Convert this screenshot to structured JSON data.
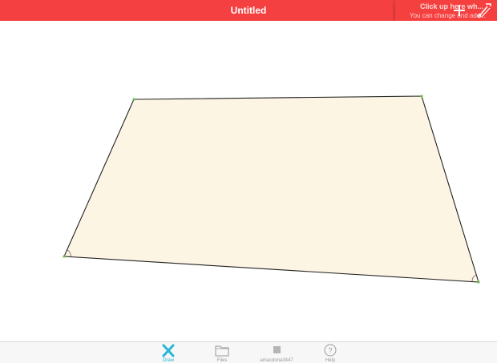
{
  "header": {
    "title": "Untitled",
    "background_color": "#f44040",
    "add_icon": "plus-icon",
    "tools_icon": "wrench-pencil-icon"
  },
  "tooltip": {
    "title": "Click up here wh...",
    "subtitle": "You can change and add..."
  },
  "canvas": {
    "shape_fill": "#fdf5e4",
    "shape_stroke": "#222222",
    "vertex_color": "#6cc04a"
  },
  "tabbar": {
    "accent_color": "#29b6d8",
    "tabs": [
      {
        "label": "Draw",
        "icon": "draw-x-icon",
        "active": true
      },
      {
        "label": "Files",
        "icon": "folder-icon",
        "active": false
      },
      {
        "label": "amacdona3447",
        "icon": "user-square-icon",
        "active": false
      },
      {
        "label": "Help",
        "icon": "question-circle-icon",
        "active": false
      }
    ]
  }
}
